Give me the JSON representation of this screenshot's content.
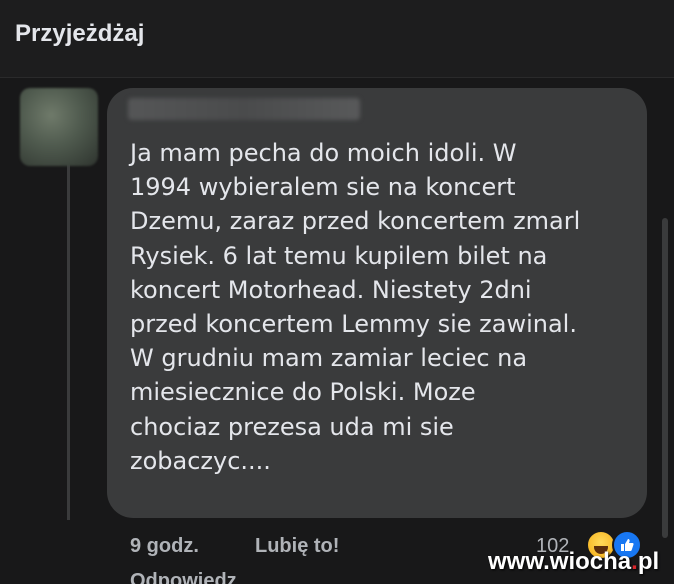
{
  "header": {
    "title": "Przyjeżdżaj"
  },
  "comment": {
    "text": "Ja mam pecha do moich idoli. W\n1994 wybieralem sie na koncert\nDzemu, zaraz przed koncertem zmarl\nRysiek. 6 lat temu kupilem bilet na\nkoncert Motorhead. Niestety 2dni\nprzed koncertem Lemmy sie zawinal.\nW grudniu mam zamiar leciec na\nmiesiecznice do Polski. Moze\nchociaz prezesa uda mi sie\nzobaczyc....",
    "time": "9 godz.",
    "like_label": "Lubię to!",
    "reply_label": "Odpowiedz",
    "reaction_count": "102",
    "reactions": [
      "haha-icon",
      "like-icon"
    ]
  },
  "watermark": {
    "prefix": "www.wiocha",
    "dot": ".",
    "suffix": "pl"
  },
  "colors": {
    "background": "#181819",
    "bubble": "#3a3b3c",
    "text": "#e4e6eb",
    "meta": "#b0b3b8",
    "like_blue": "#1877f2",
    "haha_yellow": "#f7b928"
  }
}
